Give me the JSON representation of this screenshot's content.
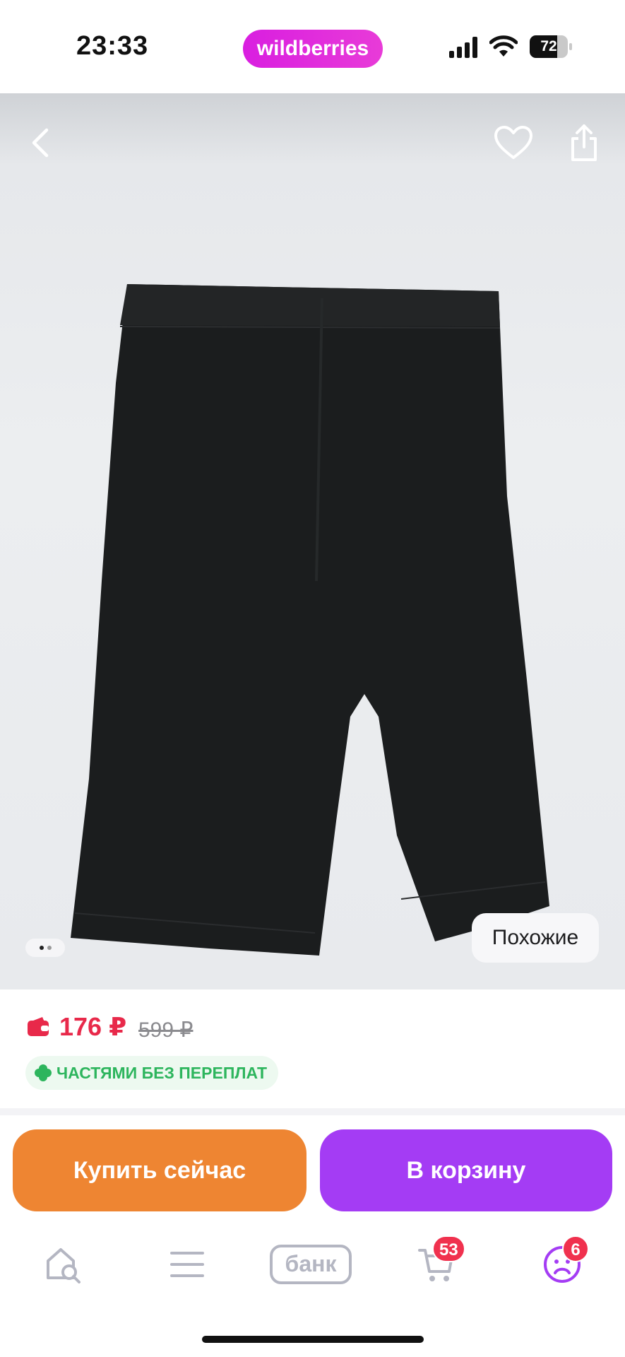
{
  "status_bar": {
    "time": "23:33",
    "brand": "wildberries",
    "battery_level": "72",
    "battery_fraction": 0.72
  },
  "photo": {
    "similar_label": "Похожие",
    "carousel_pages": 2,
    "carousel_active": 0
  },
  "price": {
    "current": "176 ₽",
    "old": "599 ₽",
    "installments": "ЧАСТЯМИ БЕЗ ПЕРЕПЛАТ"
  },
  "actions": {
    "buy_now": "Купить сейчас",
    "add_to_cart": "В корзину"
  },
  "tab_bar": {
    "bank_label": "банк",
    "cart_badge": "53",
    "profile_badge": "6"
  },
  "colors": {
    "brand": "#d91ee0",
    "price": "#e8294a",
    "buy_now": "#ee8532",
    "cart": "#a43cf4",
    "installments": "#2db55d",
    "badge": "#f0314e"
  },
  "icons": [
    "back-icon",
    "heart-icon",
    "share-icon",
    "wallet-icon",
    "clover-icon",
    "home-search-icon",
    "catalog-menu-icon",
    "bank-icon",
    "cart-icon",
    "profile-icon"
  ]
}
